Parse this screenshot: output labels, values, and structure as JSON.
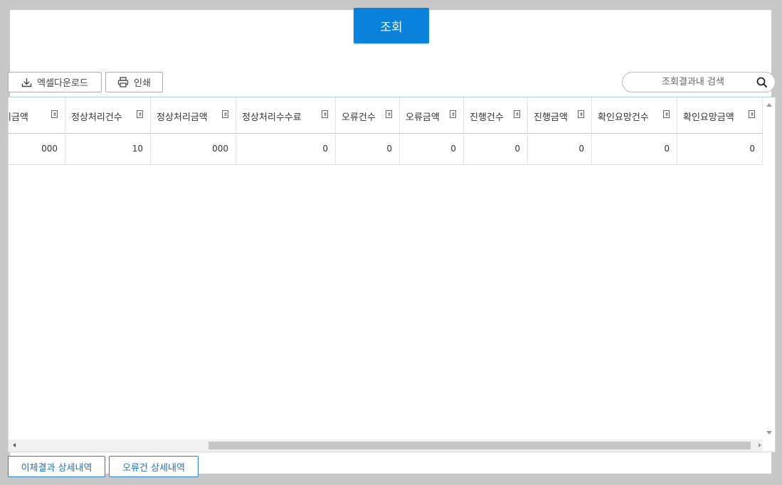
{
  "toolbar": {
    "query_label": "조회",
    "excel_label": "엑셀다운로드",
    "print_label": "인쇄"
  },
  "search": {
    "placeholder": "조회결과내 검색"
  },
  "table": {
    "columns": [
      "리금액",
      "정상처리건수",
      "정상처리금액",
      "정상처리수수료",
      "오류건수",
      "오류금액",
      "진행건수",
      "진행금액",
      "확인요망건수",
      "확인요망금액"
    ],
    "rows": [
      [
        "000",
        "10",
        "000",
        "0",
        "0",
        "0",
        "0",
        "0",
        "0",
        "0"
      ]
    ]
  },
  "bottom": {
    "transfer_detail_label": "이체결과 상세내역",
    "error_detail_label": "오류건 상세내역"
  }
}
